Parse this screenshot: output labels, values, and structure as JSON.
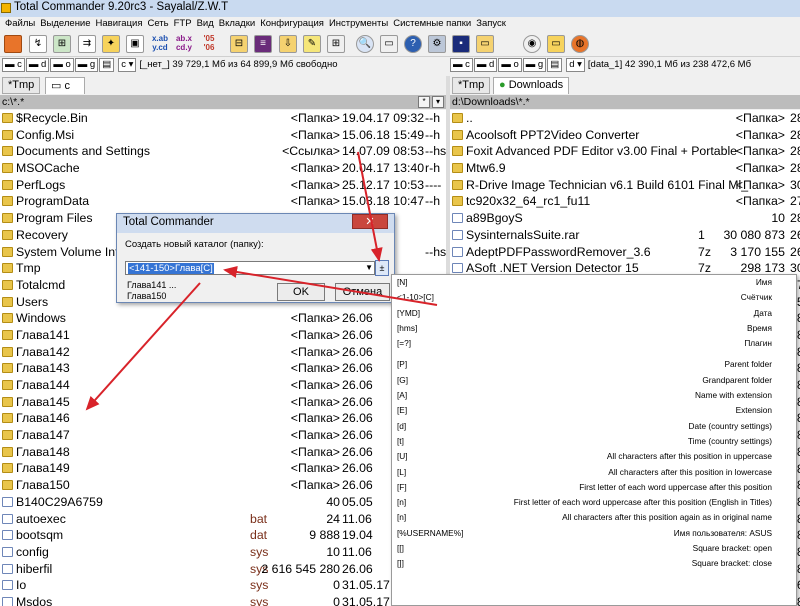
{
  "window": {
    "title": "Total Commander 9.20rc3 - Sayalal/Z.W.T"
  },
  "menu": [
    "Файлы",
    "Выделение",
    "Навигация",
    "Сеть",
    "FTP",
    "Вид",
    "Вкладки",
    "Конфигурация",
    "Инструменты",
    "Системные папки",
    "Запуск"
  ],
  "toolbar": {
    "b1": "x.ab\ny.cd",
    "b2": "ab.x\ncd.y",
    "b3": "'05\n'06"
  },
  "left": {
    "drives": [
      "c",
      "d",
      "o",
      "g"
    ],
    "drive_info": "[_нет_]  39 729,1 Мб из 64 899,9 Мб свободно",
    "tabs": [
      "*Tmp",
      "c"
    ],
    "path": "c:\\*.*",
    "rows": [
      {
        "name": "$Recycle.Bin",
        "ext": "",
        "size": "<Папка>",
        "date": "19.04.17 09:32",
        "attr": "--h",
        "type": "folder"
      },
      {
        "name": "Config.Msi",
        "ext": "",
        "size": "<Папка>",
        "date": "15.06.18 15:49",
        "attr": "--h",
        "type": "folder"
      },
      {
        "name": "Documents and Settings",
        "ext": "",
        "size": "<Ссылка>",
        "date": "14.07.09 08:53",
        "attr": "--hs",
        "type": "folder"
      },
      {
        "name": "MSOCache",
        "ext": "",
        "size": "<Папка>",
        "date": "20.04.17 13:40",
        "attr": "r-h",
        "type": "folder"
      },
      {
        "name": "PerfLogs",
        "ext": "",
        "size": "<Папка>",
        "date": "25.12.17 10:53",
        "attr": "----",
        "type": "folder"
      },
      {
        "name": "ProgramData",
        "ext": "",
        "size": "<Папка>",
        "date": "15.03.18 10:47",
        "attr": "--h",
        "type": "folder"
      },
      {
        "name": "Program Files",
        "ext": "",
        "size": "",
        "date": "",
        "attr": "",
        "type": "folder"
      },
      {
        "name": "Recovery",
        "ext": "",
        "size": "",
        "date": "",
        "attr": "",
        "type": "folder"
      },
      {
        "name": "System Volume Infor",
        "ext": "",
        "size": "",
        "date": "6:58",
        "attr": "--hs",
        "type": "folder"
      },
      {
        "name": "Tmp",
        "ext": "",
        "size": "",
        "date": "",
        "attr": "",
        "type": "folder"
      },
      {
        "name": "Totalcmd",
        "ext": "",
        "size": "",
        "date": "",
        "attr": "",
        "type": "folder"
      },
      {
        "name": "Users",
        "ext": "",
        "size": "",
        "date": "",
        "attr": "",
        "type": "folder"
      },
      {
        "name": "Windows",
        "ext": "",
        "size": "<Папка>",
        "date": "26.06",
        "attr": "",
        "type": "folder"
      },
      {
        "name": "Глава141",
        "ext": "",
        "size": "<Папка>",
        "date": "26.06",
        "attr": "",
        "type": "folder"
      },
      {
        "name": "Глава142",
        "ext": "",
        "size": "<Папка>",
        "date": "26.06",
        "attr": "",
        "type": "folder"
      },
      {
        "name": "Глава143",
        "ext": "",
        "size": "<Папка>",
        "date": "26.06",
        "attr": "",
        "type": "folder"
      },
      {
        "name": "Глава144",
        "ext": "",
        "size": "<Папка>",
        "date": "26.06",
        "attr": "",
        "type": "folder"
      },
      {
        "name": "Глава145",
        "ext": "",
        "size": "<Папка>",
        "date": "26.06",
        "attr": "",
        "type": "folder"
      },
      {
        "name": "Глава146",
        "ext": "",
        "size": "<Папка>",
        "date": "26.06",
        "attr": "",
        "type": "folder"
      },
      {
        "name": "Глава147",
        "ext": "",
        "size": "<Папка>",
        "date": "26.06",
        "attr": "",
        "type": "folder"
      },
      {
        "name": "Глава148",
        "ext": "",
        "size": "<Папка>",
        "date": "26.06",
        "attr": "",
        "type": "folder"
      },
      {
        "name": "Глава149",
        "ext": "",
        "size": "<Папка>",
        "date": "26.06",
        "attr": "",
        "type": "folder"
      },
      {
        "name": "Глава150",
        "ext": "",
        "size": "<Папка>",
        "date": "26.06",
        "attr": "",
        "type": "folder"
      },
      {
        "name": "B140C29A6759",
        "ext": "",
        "size": "40",
        "date": "05.05",
        "attr": "",
        "type": "file"
      },
      {
        "name": "autoexec",
        "ext": "bat",
        "size": "24",
        "date": "11.06",
        "attr": "",
        "type": "file"
      },
      {
        "name": "bootsqm",
        "ext": "dat",
        "size": "9 888",
        "date": "19.04",
        "attr": "",
        "type": "file"
      },
      {
        "name": "config",
        "ext": "sys",
        "size": "10",
        "date": "11.06",
        "attr": "",
        "type": "file"
      },
      {
        "name": "hiberfil",
        "ext": "sys",
        "size": "2 616 545 280",
        "date": "26.06",
        "attr": "",
        "type": "file"
      },
      {
        "name": "Io",
        "ext": "sys",
        "size": "0",
        "date": "31.05.17 16:59",
        "attr": "rah",
        "type": "file"
      },
      {
        "name": "Msdos",
        "ext": "sys",
        "size": "0",
        "date": "31.05.17 16:59",
        "attr": "rah",
        "type": "file"
      }
    ]
  },
  "right": {
    "drives": [
      "c",
      "d",
      "o",
      "g"
    ],
    "drive_info": "[data_1]  42 390,1 Мб из 238 472,6 Мб",
    "tabs": [
      "*Tmp",
      "Downloads"
    ],
    "path": "d:\\Downloads\\*.*",
    "rows": [
      {
        "name": "..",
        "ext": "",
        "size": "<Папка>",
        "date": "28",
        "type": "up"
      },
      {
        "name": "Acoolsoft PPT2Video Converter",
        "ext": "",
        "size": "<Папка>",
        "date": "28",
        "type": "folder"
      },
      {
        "name": "Foxit Advanced PDF Editor v3.00 Final + Portable",
        "ext": "",
        "size": "<Папка>",
        "date": "28",
        "type": "folder"
      },
      {
        "name": "Mtw6.9",
        "ext": "",
        "size": "<Папка>",
        "date": "28",
        "type": "folder"
      },
      {
        "name": "R-Drive Image Technician v6.1 Build 6101 Final Ml_",
        "ext": "",
        "size": "<Папка>",
        "date": "30",
        "type": "folder"
      },
      {
        "name": "tc920x32_64_rc1_fu11",
        "ext": "",
        "size": "<Папка>",
        "date": "27",
        "type": "folder"
      },
      {
        "name": "a89BgoyS",
        "ext": "",
        "size": "10",
        "date": "28",
        "type": "file"
      },
      {
        "name": "SysinternalsSuite.rar",
        "ext": "1",
        "size": "30 080 873",
        "date": "26",
        "type": "file"
      },
      {
        "name": "AdeptPDFPasswordRemover_3.6",
        "ext": "7z",
        "size": "3 170 155",
        "date": "26",
        "type": "file"
      },
      {
        "name": "ASoft .NET Version Detector 15",
        "ext": "7z",
        "size": "298 173",
        "date": "30",
        "type": "file"
      }
    ],
    "bottom_rows": [
      {
        "name": "UCMini_11.1.2.mod",
        "ext": "apk",
        "size": "3 190 390",
        "date": "26",
        "type": "file"
      },
      {
        "name": "3dvd_1.16.2",
        "ext": "exe",
        "size": "13 996 046",
        "date": "28",
        "type": "file"
      }
    ],
    "side_dates": [
      "27",
      "15",
      "28",
      "28",
      "28",
      "28",
      "28",
      "28",
      "28",
      "28",
      "28",
      "28",
      "28",
      "28",
      "28",
      "28",
      "28",
      "28"
    ]
  },
  "dialog": {
    "title": "Total Commander",
    "close": "✕",
    "label": "Создать новый каталог (папку):",
    "value": "<141-150>Глава[C]",
    "history": [
      "Глава141 ...",
      "Глава150"
    ],
    "ok": "OK",
    "cancel": "Отмена"
  },
  "popup": {
    "items": [
      {
        "k": "[N]",
        "v": "Имя"
      },
      {
        "k": "<1-10>[C]",
        "v": "Счётчик"
      },
      {
        "k": "[YMD]",
        "v": "Дата"
      },
      {
        "k": "[hms]",
        "v": "Время"
      },
      {
        "k": "[=?]",
        "v": "Плагин"
      },
      {
        "gap": true
      },
      {
        "k": "[P]",
        "v": "Parent folder"
      },
      {
        "k": "[G]",
        "v": "Grandparent folder"
      },
      {
        "k": "[A]",
        "v": "Name with extension"
      },
      {
        "k": "[E]",
        "v": "Extension"
      },
      {
        "k": "[d]",
        "v": "Date (country settings)"
      },
      {
        "k": "[t]",
        "v": "Time (country settings)"
      },
      {
        "k": "[U]",
        "v": "All characters after this position in uppercase"
      },
      {
        "k": "[L]",
        "v": "All characters after this position in lowercase"
      },
      {
        "k": "[F]",
        "v": "First letter of each word uppercase after this position"
      },
      {
        "k": "[n]",
        "v": "First letter of each word uppercase after this position (English in Titles)"
      },
      {
        "k": "[n]",
        "v": "All characters after this position again as in original name"
      },
      {
        "k": "[%USERNAME%]",
        "v": "Имя пользователя: ASUS"
      },
      {
        "k": "[[]",
        "v": "Square bracket: open"
      },
      {
        "k": "[]]",
        "v": "Square bracket: close"
      }
    ]
  },
  "colors": {
    "arrow": "#d8232a",
    "selection": "#3574d4",
    "folder": "#e9c54a",
    "ext": "#7a2f1a"
  }
}
